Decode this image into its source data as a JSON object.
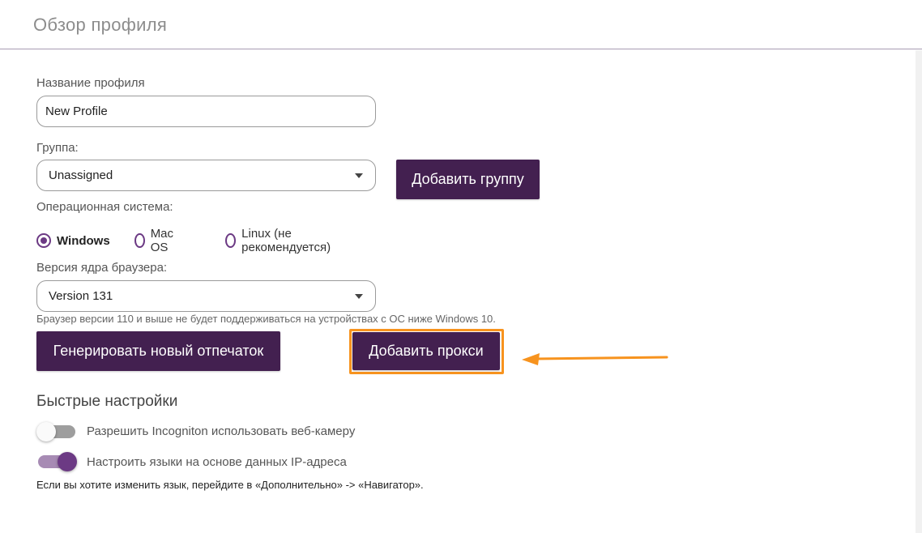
{
  "header": {
    "title": "Обзор профиля"
  },
  "profile_name": {
    "label": "Название профиля",
    "value": "New Profile"
  },
  "group": {
    "label": "Группа:",
    "selected": "Unassigned",
    "add_button": "Добавить группу"
  },
  "os": {
    "label": "Операционная система:",
    "options": [
      {
        "label": "Windows",
        "selected": true
      },
      {
        "label": "Mac OS",
        "selected": false
      },
      {
        "label": "Linux (не рекомендуется)",
        "selected": false
      }
    ]
  },
  "browser_core": {
    "label": "Версия ядра браузера:",
    "selected": "Version 131",
    "hint": "Браузер версии 110 и выше не будет поддерживаться на устройствах с ОС ниже Windows 10."
  },
  "actions": {
    "generate_fingerprint": "Генерировать новый отпечаток",
    "add_proxy": "Добавить прокси"
  },
  "quick_settings": {
    "title": "Быстрые настройки",
    "toggles": [
      {
        "label": "Разрешить Incogniton использовать веб-камеру",
        "on": false
      },
      {
        "label": "Настроить языки на основе данных IP-адреса",
        "on": true
      }
    ],
    "footnote": "Если вы хотите изменить язык, перейдите в «Дополнительно» -> «Навигатор»."
  },
  "colors": {
    "primary_button": "#432050",
    "accent": "#6c3a84",
    "highlight": "#f7931e"
  }
}
